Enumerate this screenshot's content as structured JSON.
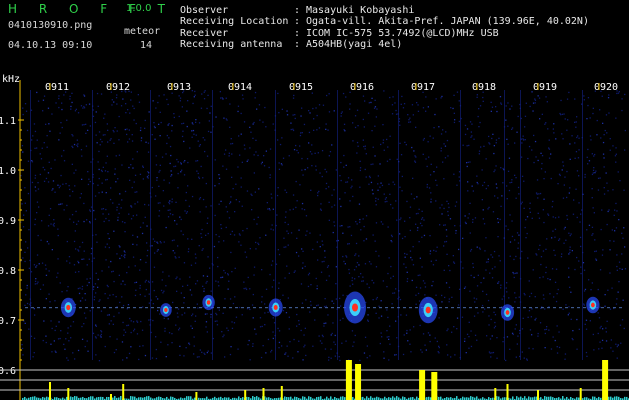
{
  "app": {
    "name": "H R O F F T",
    "version": "1.0.0"
  },
  "file": {
    "name": "0410130910.png",
    "datetime": "04.10.13 09:10"
  },
  "meteor": {
    "label": "meteor",
    "count": "14"
  },
  "info": [
    {
      "label": "Observer",
      "value": "Masayuki Kobayashi"
    },
    {
      "label": "Receiving Location",
      "value": "Ogata-vill. Akita-Pref. JAPAN (139.96E, 40.02N)"
    },
    {
      "label": "Receiver",
      "value": "ICOM IC-575 53.7492(@LCD)MHz USB"
    },
    {
      "label": "Receiving antenna",
      "value": "A504HB(yagi 4el)"
    }
  ],
  "colors": {
    "title": "#2fd04a",
    "axis": "#f0c000",
    "tick_label": "#ffffff",
    "histogram": "#ffff00",
    "background": "#000000"
  },
  "chart_data": {
    "type": "heatmap",
    "ylabel": "kHz",
    "x_ticks": [
      "0911",
      "0912",
      "0913",
      "0914",
      "0915",
      "0916",
      "0917",
      "0918",
      "0919",
      "0920"
    ],
    "y_ticks": [
      "1.1",
      "1.0",
      "0.9",
      "0.8",
      "0.7",
      "0.6"
    ],
    "ylim": [
      0.58,
      1.18
    ],
    "echoes": [
      {
        "time_min": 0.3,
        "freq_khz": 0.725,
        "strength": 0.55
      },
      {
        "time_min": 1.9,
        "freq_khz": 0.72,
        "strength": 0.35
      },
      {
        "time_min": 2.6,
        "freq_khz": 0.735,
        "strength": 0.4
      },
      {
        "time_min": 3.7,
        "freq_khz": 0.725,
        "strength": 0.5
      },
      {
        "time_min": 5.0,
        "freq_khz": 0.725,
        "strength": 1.0
      },
      {
        "time_min": 6.2,
        "freq_khz": 0.72,
        "strength": 0.8
      },
      {
        "time_min": 7.5,
        "freq_khz": 0.715,
        "strength": 0.45
      },
      {
        "time_min": 8.9,
        "freq_khz": 0.73,
        "strength": 0.45
      }
    ],
    "histogram_peaks": [
      {
        "time_min": 0.0,
        "level": 0.45
      },
      {
        "time_min": 0.3,
        "level": 0.3
      },
      {
        "time_min": 1.0,
        "level": 0.15
      },
      {
        "time_min": 1.2,
        "level": 0.4
      },
      {
        "time_min": 2.4,
        "level": 0.2
      },
      {
        "time_min": 3.2,
        "level": 0.25
      },
      {
        "time_min": 3.5,
        "level": 0.3
      },
      {
        "time_min": 3.8,
        "level": 0.35
      },
      {
        "time_min": 4.9,
        "level": 1.0
      },
      {
        "time_min": 5.05,
        "level": 0.9
      },
      {
        "time_min": 6.1,
        "level": 0.75
      },
      {
        "time_min": 6.3,
        "level": 0.7
      },
      {
        "time_min": 7.3,
        "level": 0.3
      },
      {
        "time_min": 7.5,
        "level": 0.4
      },
      {
        "time_min": 8.0,
        "level": 0.25
      },
      {
        "time_min": 8.7,
        "level": 0.3
      },
      {
        "time_min": 9.1,
        "level": 1.0
      },
      {
        "time_min": 9.7,
        "level": 0.2
      }
    ]
  }
}
